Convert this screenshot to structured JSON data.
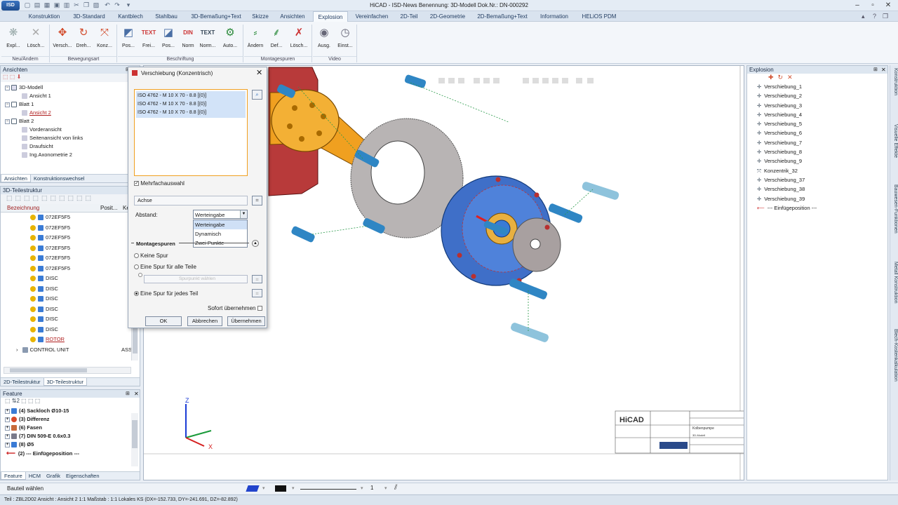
{
  "title": "HiCAD - ISD-News  Benennung: 3D-Modell  Dok.Nr.: DN-000292",
  "menu": [
    "Konstruktion",
    "3D-Standard",
    "Kantblech",
    "Stahlbau",
    "3D-Bemaßung+Text",
    "Skizze",
    "Ansichten",
    "Explosion",
    "Vereinfachen",
    "2D-Teil",
    "2D-Geometrie",
    "2D-Bemaßung+Text",
    "Information",
    "HELiOS PDM"
  ],
  "ribbon": {
    "buttons": [
      "Expl...",
      "Lösch...",
      "Versch...",
      "Dreh...",
      "Konz...",
      "Pos...",
      "Frei...",
      "Pos...",
      "Norm",
      "Norm...",
      "Auto...",
      "Ändern",
      "Def...",
      "Lösch...",
      "Ausg.",
      "Einst..."
    ],
    "groups": [
      "Neu/Ändern",
      "Bewegungsart",
      "Beschriftung",
      "Montagespuren",
      "Video"
    ]
  },
  "views_panel": {
    "header": "Ansichten",
    "tree": [
      "3D-Modell",
      "Ansicht 1",
      "Blatt 1",
      "Ansicht 2",
      "Blatt 2",
      "Vorderansicht",
      "Seitenansicht von links",
      "Draufsicht",
      "Ing.Axonometrie 2"
    ],
    "tabs": [
      "Ansichten",
      "Konstruktionswechsel"
    ]
  },
  "parts_panel": {
    "header": "3D-Teilestruktur",
    "columns": [
      "Bezeichnung",
      "Posit...",
      "Ke"
    ],
    "rows": [
      "072EF5F5",
      "072EF5F5",
      "072EF5F5",
      "072EF5F5",
      "072EF5F5",
      "072EF5F5",
      "DISC",
      "DISC",
      "DISC",
      "DISC",
      "DISC",
      "DISC",
      "ROTOR",
      "CONTROL UNIT"
    ],
    "last_code": "ASS",
    "tabs": [
      "2D-Teilestruktur",
      "3D-Teilestruktur"
    ]
  },
  "feature_panel": {
    "header": "Feature",
    "items": [
      "(4) Sackloch Ø10-15",
      "(3) Differenz",
      "(6) Fasen",
      "(7) DIN 509-E 0.6x0.3",
      "(8) Ø5",
      "(2) --- Einfügeposition ---"
    ],
    "tabs": [
      "Feature",
      "HCM",
      "Grafik",
      "Eigenschaften"
    ]
  },
  "dialog": {
    "title": "Verschiebung (Konzentrisch)",
    "list": [
      "ISO 4762 - M 10 X 70 - 8.8 [(0)]",
      "ISO 4762 - M 10 X 70 - 8.8 [(0)]",
      "ISO 4762 - M 10 X 70 - 8.8 [(0)]"
    ],
    "multi_select": "Mehrfachauswahl",
    "axis": "Achse",
    "distance_label": "Abstand:",
    "distance_value": "Werteingabe",
    "distance_options": [
      "Werteingabe",
      "Dynamisch",
      "Zwei Punkte"
    ],
    "section": "Montagespuren",
    "radio1": "Keine Spur",
    "radio2": "Eine Spur für alle Teile",
    "spur_placeholder": "Spurpunkt wählen",
    "radio3": "Eine Spur für jedes Teil",
    "apply_now": "Sofort übernehmen",
    "ok": "OK",
    "cancel": "Abbrechen",
    "apply": "Übernehmen"
  },
  "explosion_panel": {
    "header": "Explosion",
    "items": [
      "Verschiebung_1",
      "Verschiebung_2",
      "Verschiebung_3",
      "Verschiebung_4",
      "Verschiebung_5",
      "Verschiebung_6",
      "Verschiebung_7",
      "Verschiebung_8",
      "Verschiebung_9",
      "Konzentrik_32",
      "Verschiebung_37",
      "Verschiebung_38",
      "Verschiebung_39",
      "--- Einfügeposition ---"
    ]
  },
  "side_tabs": [
    "Konstruktion",
    "Visuelle Effekte",
    "Bauwesen-Funktionen",
    "Metall Konstruktion",
    "Blech-Kostenkalkulation"
  ],
  "titleblock": {
    "logo": "HiCAD",
    "name": "Kolbenpumpe",
    "sub": "3D-Modell"
  },
  "axes": {
    "z": "Z",
    "x": "X"
  },
  "prompt": "Bauteil wählen",
  "lineweight": "1",
  "statusbar": "Teil : ZBL2D02   Ansicht : Ansicht 2 1:1   Maßstab : 1:1   Lokales KS  (DX=-152.733, DY=-241.691, DZ=-82.892)",
  "colors": {
    "accent": "#2f6fb8",
    "part_blue": "#3f6fc8",
    "part_orange": "#f0a020",
    "part_red": "#b83a3a",
    "bolt": "#2f86c4"
  }
}
